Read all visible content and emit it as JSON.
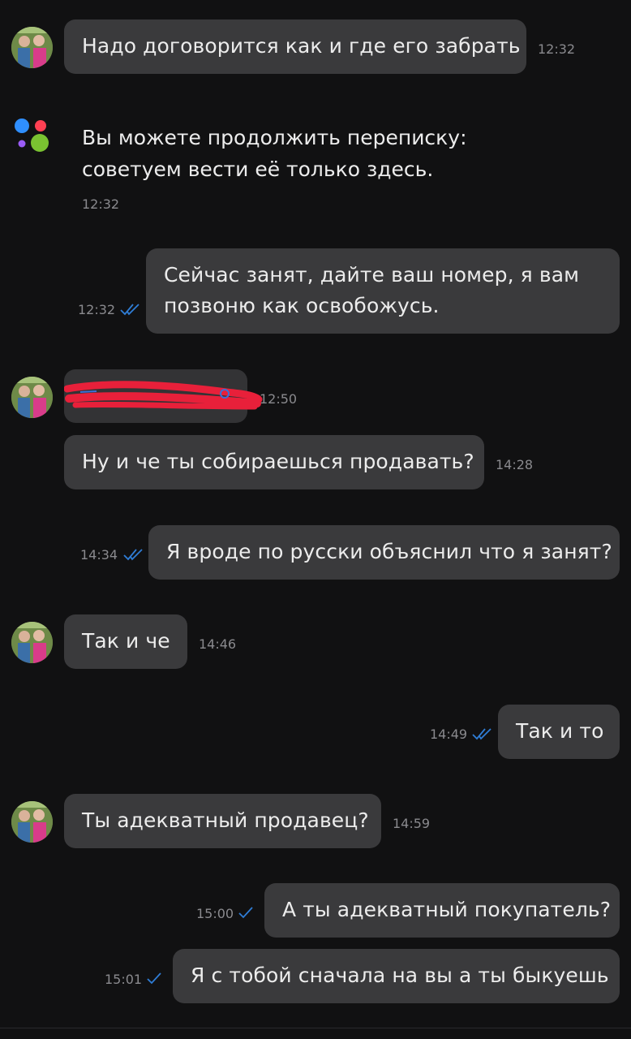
{
  "messages": [
    {
      "text": "Надо договорится как и где его забрать",
      "time": "12:32"
    },
    {
      "system_line1": "Вы можете продолжить переписку:",
      "system_line2": "советуем вести её только здесь.",
      "time": "12:32"
    },
    {
      "line1": "Сейчас занят, дайте ваш номер, я вам",
      "line2": "позвоню как освобожусь.",
      "time": "12:32"
    },
    {
      "time": "12:50"
    },
    {
      "text": "Ну и че ты собираешься продавать?",
      "time": "14:28"
    },
    {
      "text": "Я вроде по русски объяснил что я занят?",
      "time": "14:34"
    },
    {
      "text": "Так и че",
      "time": "14:46"
    },
    {
      "text": "Так и то",
      "time": "14:49"
    },
    {
      "text": "Ты адекватный продавец?",
      "time": "14:59"
    },
    {
      "text": "А ты адекватный покупатель?",
      "time": "15:00"
    },
    {
      "text": "Я с тобой сначала на вы а ты быкуешь",
      "time": "15:01"
    }
  ],
  "icons": {
    "avatar": "user-avatar-icon",
    "logo": "service-logo-icon",
    "read": "double-check-icon",
    "sent": "single-check-icon"
  },
  "colors": {
    "background": "#111112",
    "bubble": "#3a3a3c",
    "check": "#2f7dd6",
    "redaction": "#e8203a",
    "logo_blue": "#2f8fff",
    "logo_red": "#ff4053",
    "logo_purple": "#9b5cf6",
    "logo_green": "#7ac231"
  }
}
